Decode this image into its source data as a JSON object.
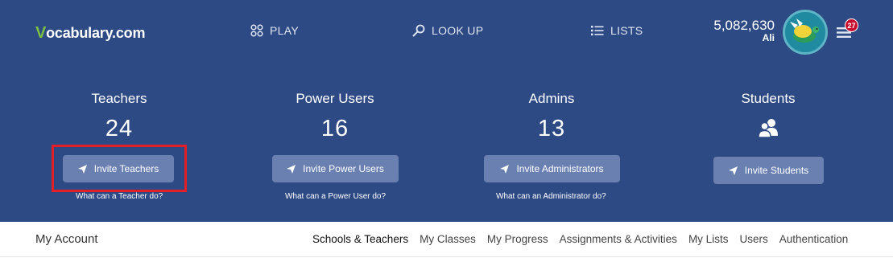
{
  "header": {
    "logo_check": "V",
    "logo_rest": "ocabulary.com",
    "nav": {
      "play": "PLAY",
      "lookup": "LOOK UP",
      "lists": "LISTS"
    },
    "points": "5,082,630",
    "username": "Ali",
    "notification_count": "27"
  },
  "stats": {
    "teachers": {
      "title": "Teachers",
      "count": "24",
      "button": "Invite Teachers",
      "link": "What can a Teacher do?"
    },
    "power_users": {
      "title": "Power Users",
      "count": "16",
      "button": "Invite Power Users",
      "link": "What can a Power User do?"
    },
    "admins": {
      "title": "Admins",
      "count": "13",
      "button": "Invite Administrators",
      "link": "What can an Administrator do?"
    },
    "students": {
      "title": "Students",
      "button": "Invite Students"
    }
  },
  "account_nav": {
    "title": "My Account",
    "tabs": [
      "Schools & Teachers",
      "My Classes",
      "My Progress",
      "Assignments & Activities",
      "My Lists",
      "Users",
      "Authentication"
    ]
  },
  "colors": {
    "header_bg": "#2e4a84",
    "button_bg": "#6a80b1",
    "logo_green": "#7bc043",
    "highlight": "#e31e24",
    "badge": "#c8102e"
  }
}
